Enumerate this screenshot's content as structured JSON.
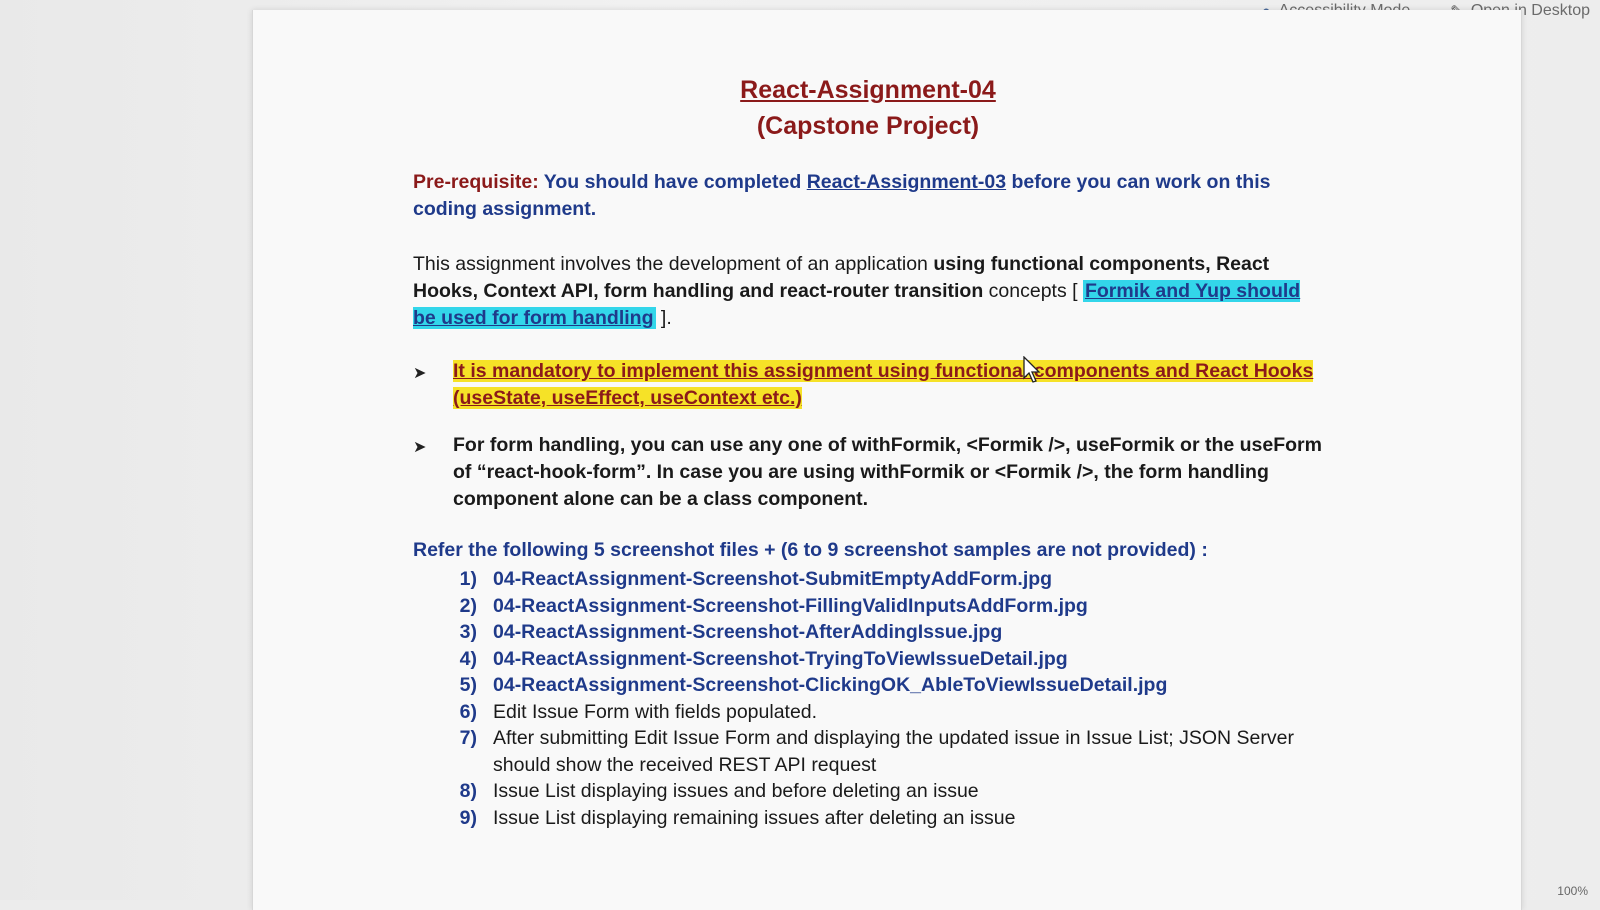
{
  "toolbar": {
    "accessibility_label": "Accessibility Mode",
    "open_desktop_label": "Open in Desktop"
  },
  "status": {
    "zoom": "100%"
  },
  "doc": {
    "title": "React-Assignment-04",
    "subtitle": "(Capstone Project)",
    "prereq_label": "Pre-requisite:",
    "prereq_text_before": " You should have completed ",
    "prereq_link": "React-Assignment-03",
    "prereq_text_after": " before you can work on this coding assignment.",
    "para_plain1": "This assignment involves the development of an application ",
    "para_bold1": "using functional components, React Hooks, Context API, form handling and react-router transition",
    "para_plain2": " concepts [ ",
    "para_highlight": "Formik and Yup should be used for form handling",
    "para_end": " ].",
    "bullet1": "It is mandatory to implement this assignment using functional components and React Hooks (useState, useEffect, useContext etc.)",
    "bullet2": "For form handling, you can use any one of withFormik, <Formik />, useFormik or the useForm of “react-hook-form”. In case you are using withFormik or <Formik />, the form handling component alone can be a class component.",
    "refer_heading": "Refer the following 5 screenshot files + (6 to 9 screenshot samples are not provided) :",
    "items": [
      {
        "num": "1)",
        "text": "04-ReactAssignment-Screenshot-SubmitEmptyAddForm.jpg"
      },
      {
        "num": "2)",
        "text": "04-ReactAssignment-Screenshot-FillingValidInputsAddForm.jpg"
      },
      {
        "num": "3)",
        "text": "04-ReactAssignment-Screenshot-AfterAddingIssue.jpg"
      },
      {
        "num": "4)",
        "text": "04-ReactAssignment-Screenshot-TryingToViewIssueDetail.jpg"
      },
      {
        "num": "5)",
        "text": "04-ReactAssignment-Screenshot-ClickingOK_AbleToViewIssueDetail.jpg"
      },
      {
        "num": "6)",
        "text": "Edit Issue Form with fields populated."
      },
      {
        "num": "7)",
        "text": "After submitting Edit Issue Form and displaying the updated issue in Issue List; JSON Server should show the received REST API request"
      },
      {
        "num": "8)",
        "text": "Issue List displaying issues and before deleting an issue"
      },
      {
        "num": "9)",
        "text": "Issue List displaying remaining issues after deleting an issue"
      }
    ]
  },
  "colors": {
    "title_red": "#8b1a1a",
    "link_blue": "#1f3a8a",
    "highlight_yellow": "#f6e227",
    "highlight_cyan": "#33d6ea"
  }
}
